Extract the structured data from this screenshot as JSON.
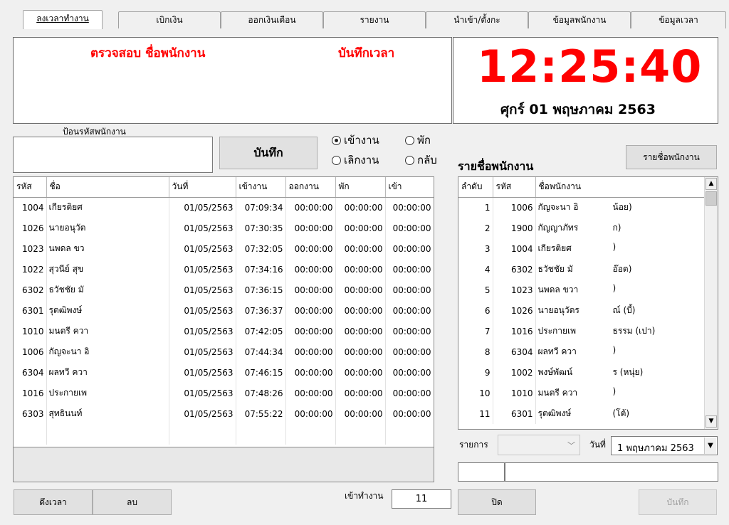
{
  "tabs": [
    {
      "label": "ลงเวลาทำงาน"
    },
    {
      "label": "เบิกเงิน"
    },
    {
      "label": "ออกเงินเดือน"
    },
    {
      "label": "รายงาน"
    },
    {
      "label": "นำเข้า/ตั้งกะ"
    },
    {
      "label": "ข้อมูลพนักงาน"
    },
    {
      "label": "ข้อมูลเวลา"
    }
  ],
  "top_panel": {
    "check_label": "ตรวจสอบ ชื่อพนักงาน",
    "record_label": "บันทึกเวลา"
  },
  "clock": {
    "time": "12:25:40",
    "date": "ศุกร์ 01 พฤษภาคม 2563"
  },
  "entry": {
    "label": "ป้อนรหัสพนักงาน",
    "value": "",
    "save_label": "บันทึก"
  },
  "radios": [
    {
      "label": "เข้างาน",
      "checked": true
    },
    {
      "label": "พัก",
      "checked": false
    },
    {
      "label": "เลิกงาน",
      "checked": false
    },
    {
      "label": "กลับ",
      "checked": false
    }
  ],
  "attendance": {
    "columns": [
      "รหัส",
      "ชื่อ",
      "วันที่",
      "เข้างาน",
      "ออกงาน",
      "พัก",
      "เข้า"
    ],
    "rows": [
      [
        "1004",
        "เกียรติยศ",
        "01/05/2563",
        "07:09:34",
        "00:00:00",
        "00:00:00",
        "00:00:00"
      ],
      [
        "1026",
        "นายอนุวัต",
        "01/05/2563",
        "07:30:35",
        "00:00:00",
        "00:00:00",
        "00:00:00"
      ],
      [
        "1023",
        "นพดล ขว",
        "01/05/2563",
        "07:32:05",
        "00:00:00",
        "00:00:00",
        "00:00:00"
      ],
      [
        "1022",
        "สุวนีย์ สุข",
        "01/05/2563",
        "07:34:16",
        "00:00:00",
        "00:00:00",
        "00:00:00"
      ],
      [
        "6302",
        "ธวัชชัย มั",
        "01/05/2563",
        "07:36:15",
        "00:00:00",
        "00:00:00",
        "00:00:00"
      ],
      [
        "6301",
        "รุตฒิพงษ์",
        "01/05/2563",
        "07:36:37",
        "00:00:00",
        "00:00:00",
        "00:00:00"
      ],
      [
        "1010",
        "มนตรี ควา",
        "01/05/2563",
        "07:42:05",
        "00:00:00",
        "00:00:00",
        "00:00:00"
      ],
      [
        "1006",
        "กัญจะนา อิ",
        "01/05/2563",
        "07:44:34",
        "00:00:00",
        "00:00:00",
        "00:00:00"
      ],
      [
        "6304",
        "ผลทวี ควา",
        "01/05/2563",
        "07:46:15",
        "00:00:00",
        "00:00:00",
        "00:00:00"
      ],
      [
        "1016",
        "ประกายเพ",
        "01/05/2563",
        "07:48:26",
        "00:00:00",
        "00:00:00",
        "00:00:00"
      ],
      [
        "6303",
        "สุทธินนท์",
        "01/05/2563",
        "07:55:22",
        "00:00:00",
        "00:00:00",
        "00:00:00"
      ]
    ]
  },
  "employee_list": {
    "title": "รายชื่อพนักงาน",
    "button_label": "รายชื่อพนักงาน",
    "columns": [
      "ลำดับ",
      "รหัส",
      "ชื่อพนักงาน"
    ],
    "rows": [
      [
        "1",
        "1006",
        "กัญจะนา อิ",
        "น้อย)"
      ],
      [
        "2",
        "1900",
        "กัญญาภัทร",
        "ก)"
      ],
      [
        "3",
        "1004",
        "เกียรติยศ",
        ")"
      ],
      [
        "4",
        "6302",
        "ธวัชชัย มั",
        "อ๊อด)"
      ],
      [
        "5",
        "1023",
        "นพดล ขวา",
        ")"
      ],
      [
        "6",
        "1026",
        "นายอนุวัตร",
        "ณ์ (บี้)"
      ],
      [
        "7",
        "1016",
        "ประกายเพ",
        "ธรรม (เปา)"
      ],
      [
        "8",
        "6304",
        "ผลทวี ควา",
        ")"
      ],
      [
        "9",
        "1002",
        "พงษ์พัฒน์",
        "ร (หนุ่ย)"
      ],
      [
        "10",
        "1010",
        "มนตรี ควา",
        ")"
      ],
      [
        "11",
        "6301",
        "รุตฒิพงษ์",
        "(โต้)"
      ]
    ]
  },
  "filter": {
    "item_label": "รายการ",
    "item_value": "",
    "date_label": "วันที่",
    "date_value": "1  พฤษภาคม  2563"
  },
  "bottom": {
    "fetch_time_label": "ดึงเวลา",
    "delete_label": "ลบ",
    "work_count_label": "เข้าทำงาน",
    "work_count_value": "11",
    "close_label": "ปิด",
    "save_label": "บันทึก"
  },
  "colors": {
    "accent_red": "#ff0000"
  }
}
